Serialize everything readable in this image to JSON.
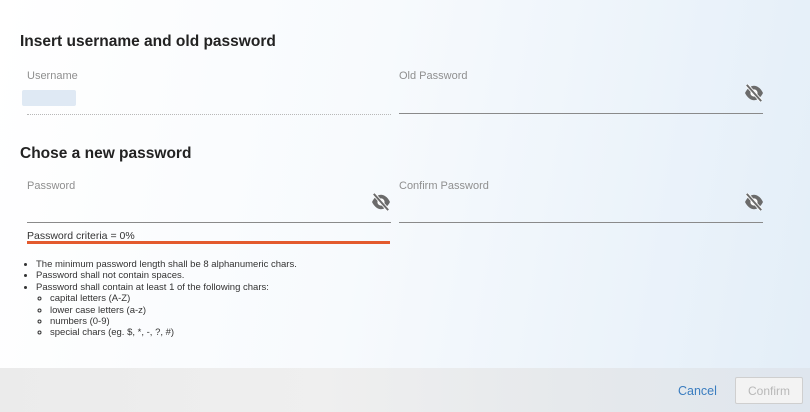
{
  "old_section": {
    "title": "Insert username and old password",
    "username_label": "Username",
    "old_password_label": "Old Password"
  },
  "new_section": {
    "title": "Chose a new password",
    "password_label": "Password",
    "confirm_label": "Confirm Password"
  },
  "criteria": {
    "text": "Password criteria = 0%",
    "strength_fraction": 0
  },
  "rules": {
    "items": [
      "The minimum password length shall be 8 alphanumeric chars.",
      "Password shall not contain spaces.",
      "Password shall contain at least 1 of the following chars:"
    ],
    "subitems": [
      "capital letters (A-Z)",
      "lower case letters (a-z)",
      "numbers (0-9)",
      "special chars (eg. $, *, -, ?, #)"
    ]
  },
  "footer": {
    "cancel_label": "Cancel",
    "confirm_label": "Confirm"
  },
  "icons": {
    "visibility": "eye-off-icon"
  },
  "colors": {
    "criteria_bar": "#e35a2e",
    "cancel_link": "#3a7dc0"
  }
}
